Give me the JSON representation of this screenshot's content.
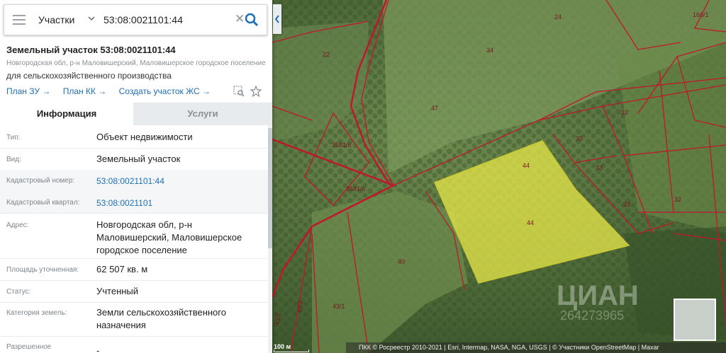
{
  "search": {
    "layer": "Участки",
    "query": "53:08:0021101:44"
  },
  "header": {
    "title": "Земельный участок 53:08:0021101:44",
    "address": "Новгородская обл, р-н Маловишерский, Маловишерское городское поселение",
    "purpose": "для сельскохозяйственного производства"
  },
  "links": {
    "plan_zu": "План ЗУ →",
    "plan_kk": "План КК →",
    "create": "Создать участок ЖС →"
  },
  "tabs": {
    "info": "Информация",
    "services": "Услуги"
  },
  "rows": [
    {
      "label": "Тип:",
      "value": "Объект недвижимости"
    },
    {
      "label": "Вид:",
      "value": "Земельный участок"
    },
    {
      "label": "Кадастровый номер:",
      "value": "53:08:0021101:44"
    },
    {
      "label": "Кадастровый квартал:",
      "value": "53:08:0021101"
    },
    {
      "label": "Адрес:",
      "value": "Новгородская обл, р-н Маловишерский, Маловишерское городское поселение"
    },
    {
      "label": "Площадь уточненная:",
      "value": "62 507 кв. м"
    },
    {
      "label": "Статус:",
      "value": "Учтенный"
    },
    {
      "label": "Категория земель:",
      "value": "Земли сельскохозяйственного назначения"
    },
    {
      "label": "Разрешенное",
      "value": "-"
    }
  ],
  "map": {
    "parcel_labels": [
      "24",
      "160/1",
      "22",
      "34",
      "47",
      "32",
      "35",
      "44",
      "33",
      "3581/6",
      "3581/6",
      "44",
      "33",
      "32",
      "40",
      "43/1",
      "43/2",
      "43/2"
    ],
    "scale": "100 м",
    "attribution": "ПКК © Росреестр 2010-2021 | Esri, Intermap, NASA, NGA, USGS | © Участники OpenStreetMap | Maxar",
    "watermark": "ЦИАН",
    "watermark_id": "264273965",
    "highlight_color": "#e8e84a",
    "boundary_color": "#c0182b"
  }
}
